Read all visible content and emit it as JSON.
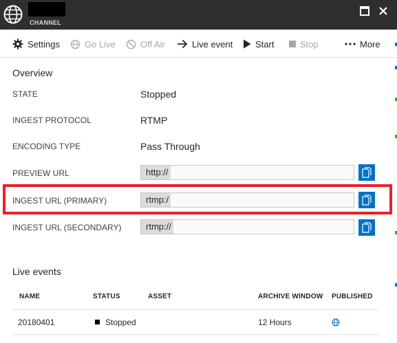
{
  "window": {
    "subtitle": "CHANNEL"
  },
  "toolbar": {
    "items": [
      {
        "label": "Settings",
        "icon": "gear-icon",
        "enabled": true
      },
      {
        "label": "Go Live",
        "icon": "globe-icon",
        "enabled": false
      },
      {
        "label": "Off Air",
        "icon": "prohibited-icon",
        "enabled": false
      },
      {
        "label": "Live event",
        "icon": "arrow-right-icon",
        "enabled": true
      },
      {
        "label": "Start",
        "icon": "play-icon",
        "enabled": true
      },
      {
        "label": "Stop",
        "icon": "stop-icon",
        "enabled": false
      },
      {
        "label": "More",
        "icon": "ellipsis-icon",
        "enabled": true
      }
    ]
  },
  "overview": {
    "title": "Overview",
    "state": {
      "label": "STATE",
      "value": "Stopped"
    },
    "ingest_protocol": {
      "label": "INGEST PROTOCOL",
      "value": "RTMP"
    },
    "encoding_type": {
      "label": "ENCODING TYPE",
      "value": "Pass Through"
    },
    "preview_url": {
      "label": "PREVIEW URL",
      "value": "http://"
    },
    "ingest_primary": {
      "label": "INGEST URL (PRIMARY)",
      "value": "rtmp:/"
    },
    "ingest_secondary": {
      "label": "INGEST URL (SECONDARY)",
      "value": "rtmp://"
    }
  },
  "live_events": {
    "title": "Live events",
    "columns": [
      "NAME",
      "STATUS",
      "ASSET",
      "ARCHIVE WINDOW",
      "PUBLISHED"
    ],
    "rows": [
      {
        "name": "20180401",
        "status": "Stopped",
        "asset": "",
        "archive_window": "12 Hours",
        "published_icon": "globe-icon"
      }
    ]
  },
  "colors": {
    "titlebar": "#2f2f2f",
    "accent": "#0072c6",
    "highlight": "#e8202a"
  }
}
